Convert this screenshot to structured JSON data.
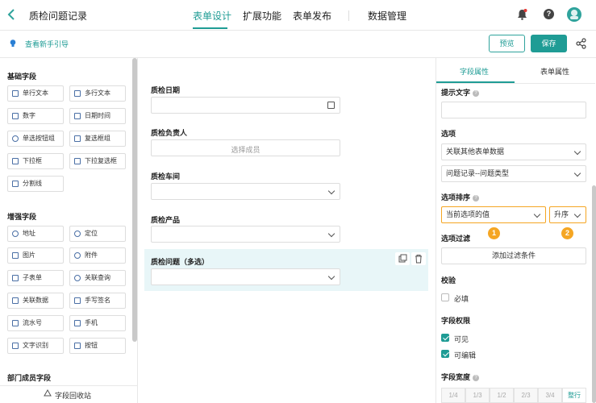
{
  "header": {
    "title": "质检问题记录",
    "tabs": [
      "表单设计",
      "扩展功能",
      "表单发布",
      "数据管理"
    ],
    "active_tab": "表单设计"
  },
  "subbar": {
    "guide": "查看新手引导",
    "preview": "预览",
    "save": "保存"
  },
  "left_panel": {
    "basic_title": "基础字段",
    "basic": [
      "单行文本",
      "多行文本",
      "数字",
      "日期时间",
      "单选按钮组",
      "复选框组",
      "下拉框",
      "下拉复选框",
      "分割线"
    ],
    "enhanced_title": "增强字段",
    "enhanced": [
      "地址",
      "定位",
      "图片",
      "附件",
      "子表单",
      "关联查询",
      "关联数据",
      "手写签名",
      "流水号",
      "手机",
      "文字识别",
      "按钮"
    ],
    "dept_title": "部门成员字段",
    "recycle": "字段回收站"
  },
  "canvas": {
    "f1_label": "质检日期",
    "f2_label": "质检负责人",
    "f2_placeholder": "选择成员",
    "f3_label": "质检车间",
    "f4_label": "质检产品",
    "f5_label": "质检问题（多选）"
  },
  "right_panel": {
    "tab_field": "字段属性",
    "tab_form": "表单属性",
    "hint_label": "提示文字",
    "options_label": "选项",
    "options_source": "关联其他表单数据",
    "options_form": "问题记录--问题类型",
    "sort_label": "选项排序",
    "sort_by": "当前选项的值",
    "sort_order": "升序",
    "badge1": "1",
    "badge2": "2",
    "filter_label": "选项过滤",
    "filter_button": "添加过滤条件",
    "validate_label": "校验",
    "required": "必填",
    "perm_label": "字段权限",
    "visible": "可见",
    "editable": "可编辑",
    "width_label": "字段宽度",
    "widths": [
      "1/4",
      "1/3",
      "1/2",
      "2/3",
      "3/4",
      "整行"
    ],
    "colors": {
      "accent": "#1f9c95",
      "highlight": "#f5a623"
    }
  }
}
